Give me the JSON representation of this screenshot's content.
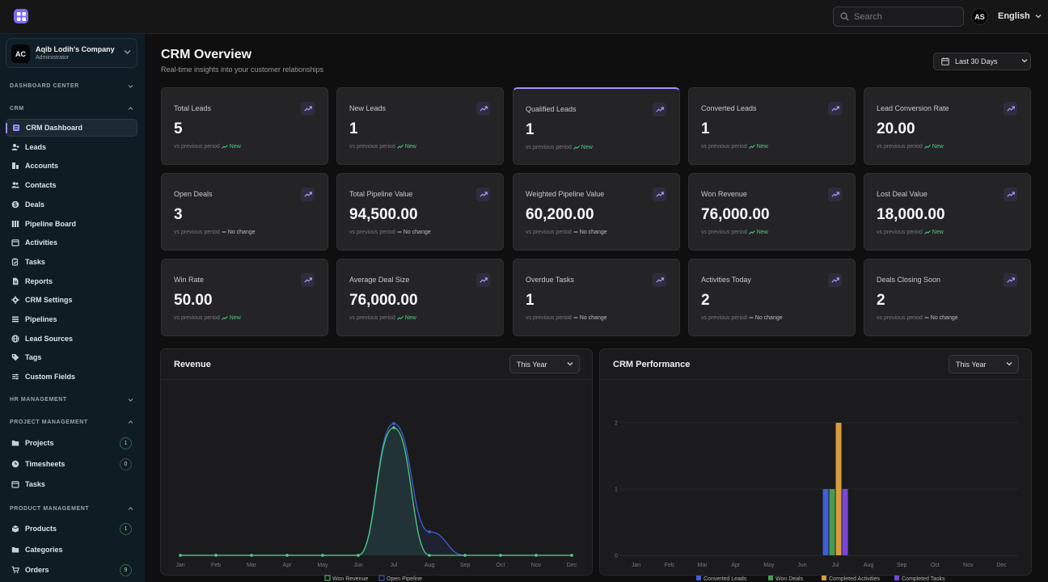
{
  "topbar": {
    "search_placeholder": "Search",
    "avatar_initials": "AS",
    "language": "English"
  },
  "sidebar": {
    "company": {
      "initials": "AC",
      "name": "Aqib Lodih's Company",
      "role": "Administrator"
    },
    "sections": {
      "dashboard_center": "DASHBOARD CENTER",
      "crm": "CRM",
      "hr": "HR MANAGEMENT",
      "project": "PROJECT MANAGEMENT",
      "product": "PRODUCT MANAGEMENT"
    },
    "crm_items": [
      {
        "label": "CRM Dashboard",
        "icon": "dashboard-icon",
        "active": true
      },
      {
        "label": "Leads",
        "icon": "user-plus-icon"
      },
      {
        "label": "Accounts",
        "icon": "building-icon"
      },
      {
        "label": "Contacts",
        "icon": "users-icon"
      },
      {
        "label": "Deals",
        "icon": "dollar-icon"
      },
      {
        "label": "Pipeline Board",
        "icon": "columns-icon"
      },
      {
        "label": "Activities",
        "icon": "calendar-icon"
      },
      {
        "label": "Tasks",
        "icon": "clipboard-icon"
      },
      {
        "label": "Reports",
        "icon": "file-icon"
      },
      {
        "label": "CRM Settings",
        "icon": "gear-icon"
      },
      {
        "label": "Pipelines",
        "icon": "list-icon"
      },
      {
        "label": "Lead Sources",
        "icon": "globe-icon"
      },
      {
        "label": "Tags",
        "icon": "tag-icon"
      },
      {
        "label": "Custom Fields",
        "icon": "sliders-icon"
      }
    ],
    "project_items": [
      {
        "label": "Projects",
        "icon": "folder-icon",
        "badge": "1",
        "badge_color": "green"
      },
      {
        "label": "Timesheets",
        "icon": "clock-icon",
        "badge": "0",
        "badge_color": "gray"
      },
      {
        "label": "Tasks",
        "icon": "calendar-icon"
      }
    ],
    "product_items": [
      {
        "label": "Products",
        "icon": "box-icon",
        "badge": "1",
        "badge_color": "green"
      },
      {
        "label": "Categories",
        "icon": "folder-icon"
      },
      {
        "label": "Orders",
        "icon": "cart-icon",
        "badge": "9",
        "badge_color": "green"
      }
    ]
  },
  "header": {
    "title": "CRM Overview",
    "subtitle": "Real-time insights into your customer relationships",
    "range": "Last 30 Days"
  },
  "footer_prefix": "vs previous period",
  "cards": [
    {
      "label": "Total Leads",
      "value": "5",
      "change": "New",
      "kind": "new"
    },
    {
      "label": "New Leads",
      "value": "1",
      "change": "New",
      "kind": "new"
    },
    {
      "label": "Qualified Leads",
      "value": "1",
      "change": "New",
      "kind": "new",
      "highlight": true
    },
    {
      "label": "Converted Leads",
      "value": "1",
      "change": "New",
      "kind": "new"
    },
    {
      "label": "Lead Conversion Rate",
      "value": "20.00",
      "change": "New",
      "kind": "new"
    },
    {
      "label": "Open Deals",
      "value": "3",
      "change": "No change",
      "kind": "none"
    },
    {
      "label": "Total Pipeline Value",
      "value": "94,500.00",
      "change": "No change",
      "kind": "none"
    },
    {
      "label": "Weighted Pipeline Value",
      "value": "60,200.00",
      "change": "No change",
      "kind": "none"
    },
    {
      "label": "Won Revenue",
      "value": "76,000.00",
      "change": "New",
      "kind": "new"
    },
    {
      "label": "Lost Deal Value",
      "value": "18,000.00",
      "change": "New",
      "kind": "new"
    },
    {
      "label": "Win Rate",
      "value": "50.00",
      "change": "New",
      "kind": "new"
    },
    {
      "label": "Average Deal Size",
      "value": "76,000.00",
      "change": "New",
      "kind": "new"
    },
    {
      "label": "Overdue Tasks",
      "value": "1",
      "change": "No change",
      "kind": "none"
    },
    {
      "label": "Activities Today",
      "value": "2",
      "change": "No change",
      "kind": "none"
    },
    {
      "label": "Deals Closing Soon",
      "value": "2",
      "change": "No change",
      "kind": "none"
    }
  ],
  "colors": {
    "accent": "#9d92ff",
    "green": "#4ccf7f",
    "blue": "#3f5fd6",
    "won_deals": "#4a9a4f",
    "activities": "#d99b3f",
    "tasks": "#7a45d8"
  },
  "revenue_panel": {
    "title": "Revenue",
    "period": "This Year",
    "chart_data": {
      "type": "area",
      "categories": [
        "Jan",
        "Feb",
        "Mar",
        "Apr",
        "May",
        "Jun",
        "Jul",
        "Aug",
        "Sep",
        "Oct",
        "Nov",
        "Dec"
      ],
      "series": [
        {
          "name": "Won Revenue",
          "values": [
            0,
            0,
            0,
            0,
            0,
            0,
            76000,
            0,
            0,
            0,
            0,
            0
          ]
        },
        {
          "name": "Open Pipeline",
          "values": [
            0,
            0,
            0,
            0,
            0,
            0,
            78500,
            14000,
            0,
            0,
            0,
            0
          ]
        }
      ],
      "ylim": [
        0,
        90000
      ],
      "legend": "bottom"
    }
  },
  "performance_panel": {
    "title": "CRM Performance",
    "period": "This Year",
    "chart_data": {
      "type": "bar",
      "categories": [
        "Jan",
        "Feb",
        "Mar",
        "Apr",
        "May",
        "Jun",
        "Jul",
        "Aug",
        "Sep",
        "Oct",
        "Nov",
        "Dec"
      ],
      "yticks": [
        "0",
        "1",
        "2"
      ],
      "ylim": [
        0,
        2
      ],
      "series": [
        {
          "name": "Converted Leads",
          "values": [
            0,
            0,
            0,
            0,
            0,
            0,
            1,
            0,
            0,
            0,
            0,
            0
          ]
        },
        {
          "name": "Won Deals",
          "values": [
            0,
            0,
            0,
            0,
            0,
            0,
            1,
            0,
            0,
            0,
            0,
            0
          ]
        },
        {
          "name": "Completed Activities",
          "values": [
            0,
            0,
            0,
            0,
            0,
            0,
            2,
            0,
            0,
            0,
            0,
            0
          ]
        },
        {
          "name": "Completed Tasks",
          "values": [
            0,
            0,
            0,
            0,
            0,
            0,
            1,
            0,
            0,
            0,
            0,
            0
          ]
        }
      ],
      "grid": true,
      "legend": "bottom"
    }
  }
}
